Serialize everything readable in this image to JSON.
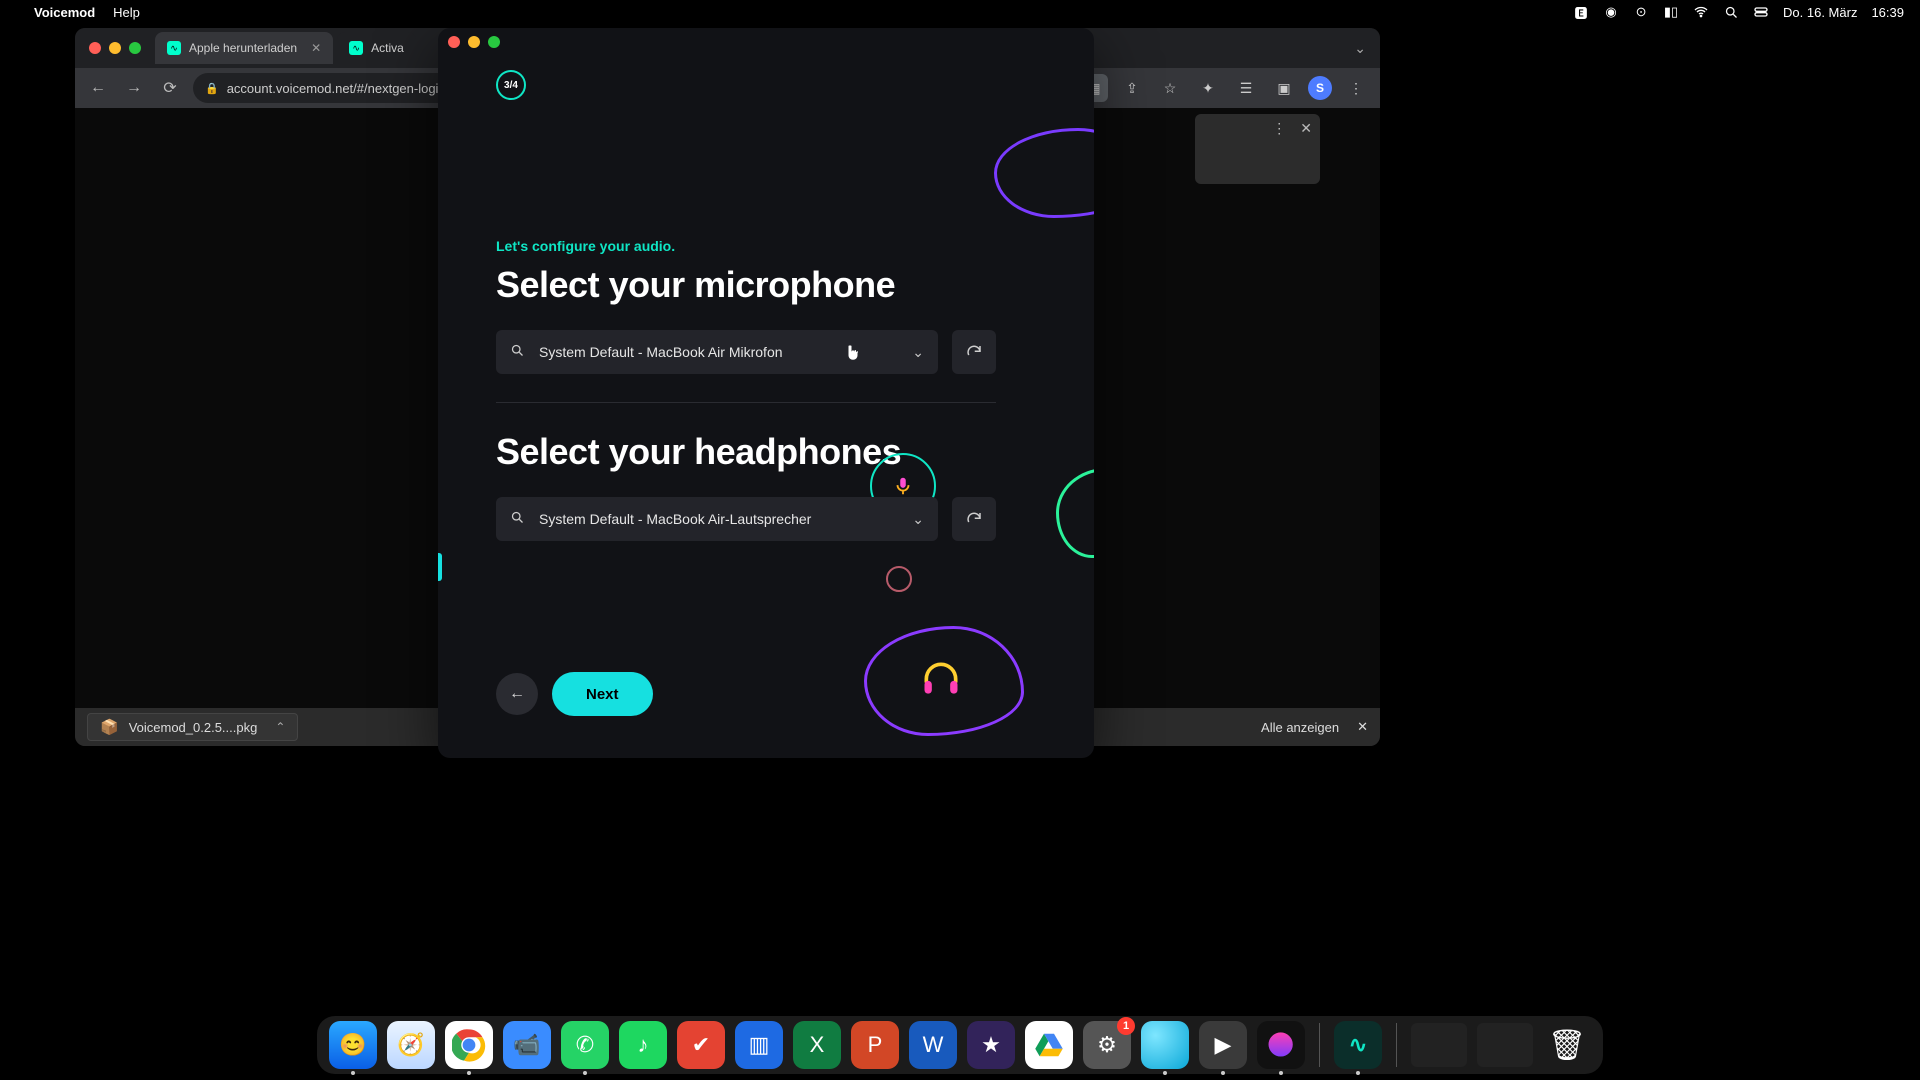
{
  "menubar": {
    "app": "Voicemod",
    "help": "Help",
    "date": "Do. 16. März",
    "time": "16:39"
  },
  "chrome": {
    "tab1": "Apple herunterladen",
    "tab2": "Activa",
    "url": "account.voicemod.net/#/nextgen-login",
    "avatar_initial": "S",
    "download_item": "Voicemod_0.2.5....pkg",
    "show_all": "Alle anzeigen"
  },
  "vm": {
    "progress": "3/4",
    "lead": "Let's configure your audio.",
    "h_mic": "Select your microphone",
    "mic_value": "System Default - MacBook Air Mikrofon",
    "h_hp": "Select your headphones",
    "hp_value": "System Default - MacBook Air-Lautsprecher",
    "next": "Next"
  },
  "dock": {
    "settings_badge": "1"
  }
}
